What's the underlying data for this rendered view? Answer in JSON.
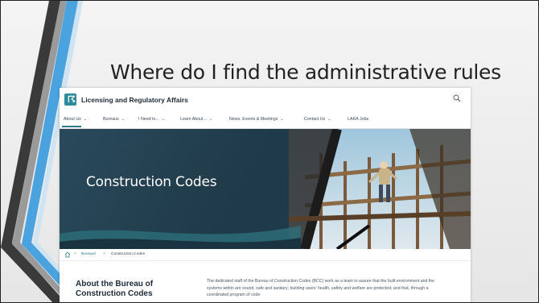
{
  "slide": {
    "title": "Where do I find the administrative rules"
  },
  "site": {
    "logo_mark": "☈",
    "name": "Licensing and Regulatory Affairs",
    "nav": [
      {
        "label": "About Us",
        "chev": "⌄"
      },
      {
        "label": "Bureaus",
        "chev": "⌄"
      },
      {
        "label": "I Need to...",
        "chev": "⌄"
      },
      {
        "label": "Learn About...",
        "chev": "⌄"
      },
      {
        "label": "News, Events & Meetings",
        "chev": "⌄"
      },
      {
        "label": "Contact Us",
        "chev": "⌄"
      },
      {
        "label": "LARA Jobs",
        "chev": ""
      }
    ],
    "hero_title": "Construction Codes",
    "breadcrumb": {
      "sep": ">",
      "items": [
        "Bureaus",
        "Construction Codes"
      ]
    },
    "about_heading": "About the Bureau of Construction Codes",
    "about_text": "The dedicated staff of the Bureau of Construction Codes (BCC) work as a team to assure that the built environment and the systems within are sound, safe and sanitary; building users' health, safety and welfare are protected; and that, through a coordinated program of code"
  },
  "colors": {
    "accent": "#2c7a8a",
    "hero_bg": "#23404f",
    "deco_blue": "#4aa3df",
    "deco_dark": "#3a3a3a"
  }
}
